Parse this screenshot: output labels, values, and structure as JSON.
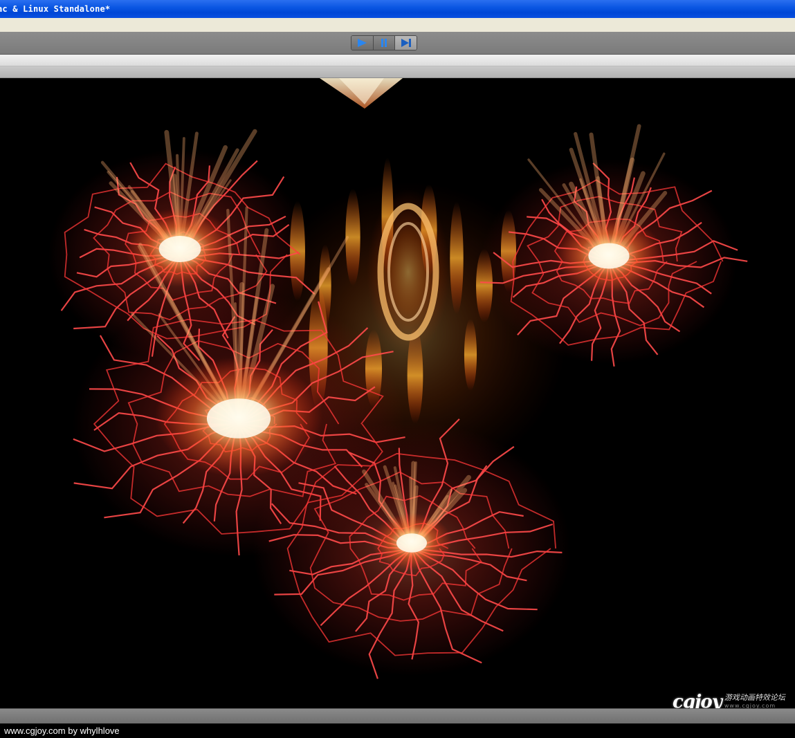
{
  "window": {
    "title": "ac & Linux Standalone*"
  },
  "toolbar": {
    "play_icon": "play-icon",
    "pause_icon": "pause-icon",
    "step_icon": "step-forward-icon",
    "accent": "#1e6fe0"
  },
  "watermark": {
    "logo": "cgjoy",
    "cn": "游戏动画特效论坛",
    "url": "www.cgjoy.com"
  },
  "footer": {
    "credit": "www.cgjoy.com by whylhlove"
  }
}
